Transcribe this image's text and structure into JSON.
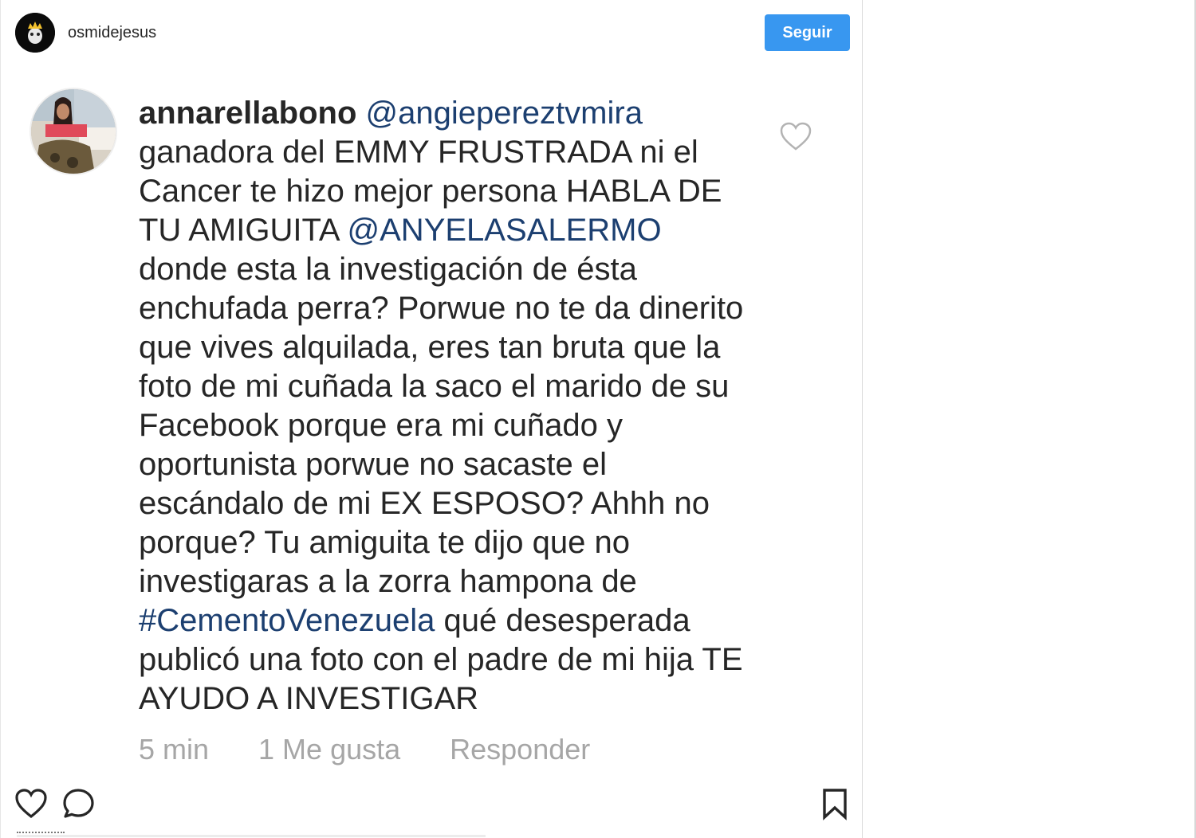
{
  "header": {
    "username": "osmidejesus",
    "follow_label": "Seguir"
  },
  "comment": {
    "author": "annarellabono",
    "segments": [
      {
        "type": "mention",
        "text": "@angiepereztvmira"
      },
      {
        "type": "text",
        "text": "ganadora del EMMY FRUSTRADA ni el Cancer te hizo mejor persona HABLA DE TU AMIGUITA "
      },
      {
        "type": "mention",
        "text": "@ANYELASALERMO"
      },
      {
        "type": "text",
        "text": "donde esta la investigación de ésta enchufada perra? Porwue no te da dinerito que vives alquilada, eres tan bruta que la foto de mi cuñada la saco el marido de su Facebook porque era mi cuñado y oportunista porwue no sacaste el escándalo de mi EX ESPOSO? Ahhh no porque? Tu amiguita te dijo que no investigaras a la zorra hampona de "
      },
      {
        "type": "hashtag",
        "text": "#CementoVenezuela"
      },
      {
        "type": "text",
        "text": "qué desesperada publicó una foto con el padre de mi hija TE AYUDO A INVESTIGAR"
      }
    ],
    "time": "5 min",
    "likes": "1 Me gusta",
    "reply_label": "Responder",
    "like_icon": "heart-outline-icon"
  },
  "actions": {
    "like_icon": "heart-icon",
    "comment_icon": "comment-bubble-icon",
    "save_icon": "bookmark-icon"
  },
  "colors": {
    "follow_button": "#3897f0",
    "link": "#1c3f70",
    "meta": "#a6a6a6",
    "text": "#262626"
  }
}
